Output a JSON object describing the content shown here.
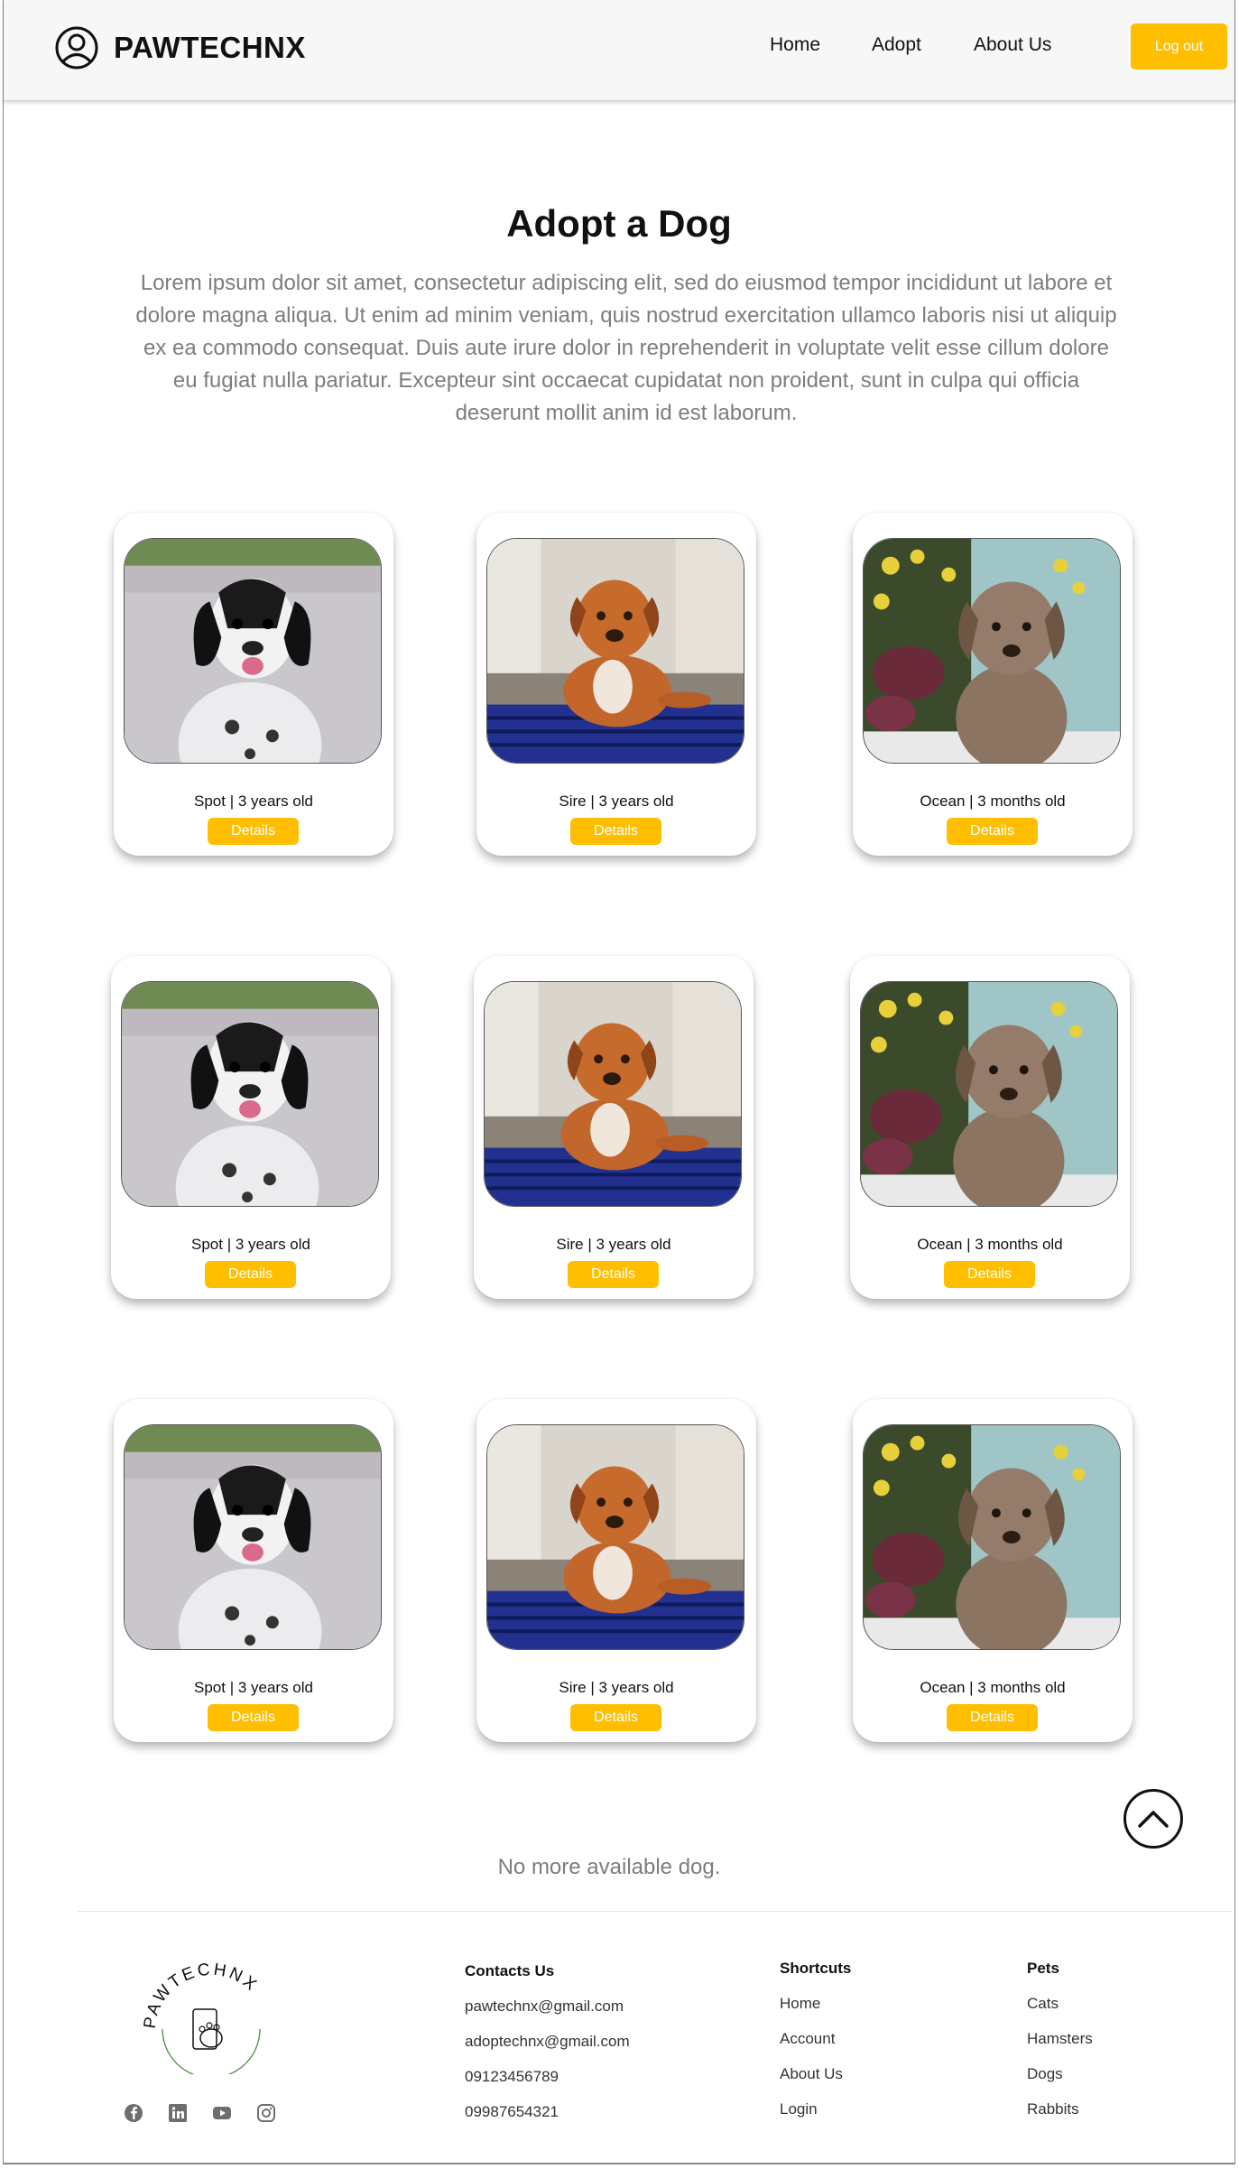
{
  "header": {
    "brand": "PAWTECHNX",
    "nav": [
      "Home",
      "Adopt",
      "About Us"
    ],
    "logout_label": "Log out"
  },
  "hero": {
    "title": "Adopt a Dog",
    "intro": "Lorem ipsum dolor sit amet, consectetur adipiscing elit, sed do eiusmod tempor incididunt ut labore et dolore magna aliqua. Ut enim ad minim veniam, quis nostrud exercitation ullamco laboris nisi ut aliquip ex ea commodo consequat. Duis aute irure dolor in reprehenderit in voluptate velit esse cillum dolore eu fugiat nulla pariatur. Excepteur sint occaecat cupidatat non proident, sunt in culpa qui officia deserunt mollit anim id est laborum."
  },
  "dogs": [
    {
      "caption": "Spot | 3 years old",
      "button": "Details"
    },
    {
      "caption": "Sire | 3 years old",
      "button": "Details"
    },
    {
      "caption": "Ocean | 3 months old",
      "button": "Details"
    },
    {
      "caption": "Spot | 3 years old",
      "button": "Details"
    },
    {
      "caption": "Sire | 3 years old",
      "button": "Details"
    },
    {
      "caption": "Ocean | 3 months old",
      "button": "Details"
    },
    {
      "caption": "Spot | 3 years old",
      "button": "Details"
    },
    {
      "caption": "Sire | 3 years old",
      "button": "Details"
    },
    {
      "caption": "Ocean | 3 months old",
      "button": "Details"
    }
  ],
  "end_note": "No more available dog.",
  "footer": {
    "logo_text": "PAWTECHNX",
    "contacts": {
      "heading": "Contacts Us",
      "items": [
        "pawtechnx@gmail.com",
        "adoptechnx@gmail.com",
        "09123456789",
        "09987654321"
      ]
    },
    "shortcuts": {
      "heading": "Shortcuts",
      "items": [
        "Home",
        "Account",
        "About Us",
        "Login"
      ]
    },
    "pets": {
      "heading": "Pets",
      "items": [
        "Cats",
        "Hamsters",
        "Dogs",
        "Rabbits"
      ]
    },
    "social_icons": [
      "facebook-icon",
      "linkedin-icon",
      "youtube-icon",
      "instagram-icon"
    ]
  },
  "colors": {
    "accent": "#ffbf00",
    "muted_text": "#7d7d7d",
    "header_bg": "#f7f7f7"
  }
}
